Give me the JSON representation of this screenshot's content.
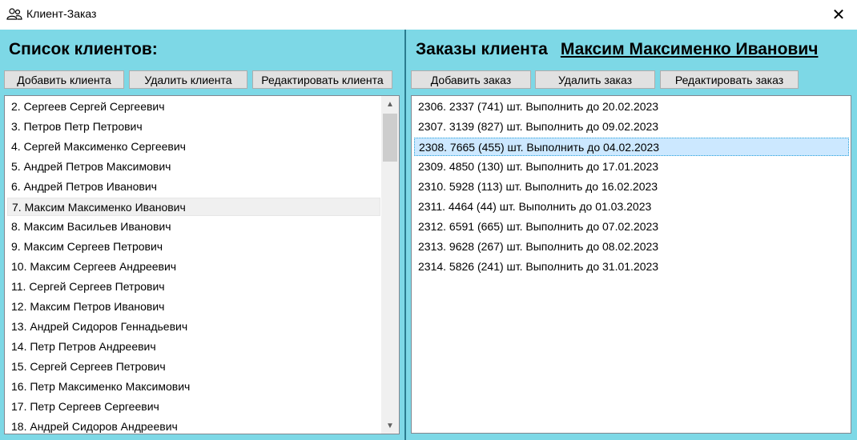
{
  "window": {
    "title": "Клиент-Заказ",
    "close_label": "✕"
  },
  "clients_pane": {
    "heading": "Список клиентов:",
    "add_button": "Добавить клиента",
    "delete_button": "Удалить клиента",
    "edit_button": "Редактировать клиента",
    "items": [
      "2. Сергеев Сергей Сергеевич",
      "3. Петров Петр Петрович",
      "4. Сергей Максименко Сергеевич",
      "5. Андрей Петров Максимович",
      "6. Андрей Петров Иванович",
      "7. Максим Максименко Иванович",
      "8. Максим Васильев Иванович",
      "9. Максим Сергеев Петрович",
      "10. Максим Сергеев Андреевич",
      "11. Сергей Сергеев Петрович",
      "12. Максим Петров Иванович",
      "13. Андрей Сидоров Геннадьевич",
      "14. Петр Петров Андреевич",
      "15. Сергей Сергеев Петрович",
      "16. Петр Максименко Максимович",
      "17. Петр Сергеев Сергеевич",
      "18. Андрей Сидоров Андреевич"
    ],
    "selected_index": 5
  },
  "orders_pane": {
    "heading": "Заказы клиента",
    "client_name": "Максим Максименко Иванович",
    "add_button": "Добавить заказ",
    "delete_button": "Удалить заказ",
    "edit_button": "Редактировать заказ",
    "items": [
      "2306. 2337 (741) шт. Выполнить до 20.02.2023",
      "2307. 3139 (827) шт. Выполнить до 09.02.2023",
      "2308. 7665 (455) шт. Выполнить до 04.02.2023",
      "2309. 4850 (130) шт. Выполнить до 17.01.2023",
      "2310. 5928 (113) шт. Выполнить до 16.02.2023",
      "2311. 4464 (44) шт. Выполнить до 01.03.2023",
      "2312. 6591 (665) шт. Выполнить до 07.02.2023",
      "2313. 9628 (267) шт. Выполнить до 08.02.2023",
      "2314. 5826 (241) шт. Выполнить до 31.01.2023"
    ],
    "selected_index": 2
  },
  "colors": {
    "background": "#7dd8e6",
    "divider": "#2a7c8f",
    "selection": "#cce8ff"
  },
  "icons": {
    "app": "users-icon",
    "scroll_up": "chevron-up-icon",
    "scroll_down": "chevron-down-icon"
  }
}
